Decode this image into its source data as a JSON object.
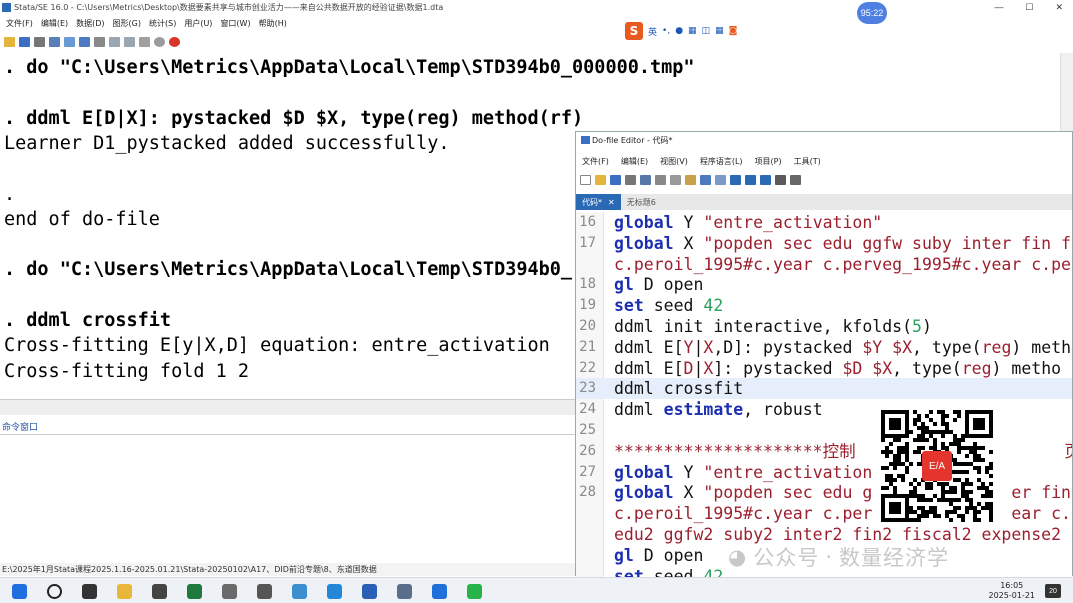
{
  "main_window": {
    "title": "Stata/SE 16.0 - C:\\Users\\Metrics\\Desktop\\数据要素共享与城市创业活力——来自公共数据开放的经验证据\\数据1.dta",
    "menu": [
      "文件(F)",
      "编辑(E)",
      "数据(D)",
      "图形(G)",
      "统计(S)",
      "用户(U)",
      "窗口(W)",
      "帮助(H)"
    ],
    "win_ctrls": [
      "—",
      "☐",
      "✕"
    ]
  },
  "ime": {
    "logo": "S",
    "label": "英"
  },
  "clock_badge": "95:22",
  "results": {
    "lines": [
      {
        "text": ". do \"C:\\Users\\Metrics\\AppData\\Local\\Temp\\STD394b0_000000.tmp\"",
        "cmd": true
      },
      {
        "text": "",
        "cmd": false
      },
      {
        "text": ". ddml E[D|X]: pystacked $D $X, type(reg) method(rf)",
        "cmd": true
      },
      {
        "text": "Learner D1_pystacked added successfully.",
        "cmd": false
      },
      {
        "text": "",
        "cmd": false
      },
      {
        "text": ".",
        "cmd": false
      },
      {
        "text": "end of do-file",
        "cmd": false
      },
      {
        "text": "",
        "cmd": false
      },
      {
        "text": ". do \"C:\\Users\\Metrics\\AppData\\Local\\Temp\\STD394b0_",
        "cmd": true
      },
      {
        "text": "",
        "cmd": false
      },
      {
        "text": ". ddml crossfit",
        "cmd": true
      },
      {
        "text": "Cross-fitting E[y|X,D] equation: entre_activation",
        "cmd": false
      },
      {
        "text": "Cross-fitting fold 1 2",
        "cmd": false
      }
    ]
  },
  "command_window_label": "命令窗口",
  "status_path": "E:\\2025年1月Stata课程2025.1.16-2025.01.21\\Stata-20250102\\A17、DID前沿专题\\8、东道国数据",
  "editor": {
    "title": "Do-file Editor - 代码*",
    "menu": [
      "文件(F)",
      "编辑(E)",
      "视图(V)",
      "程序语言(L)",
      "项目(P)",
      "工具(T)"
    ],
    "tabs": [
      {
        "label": "代码*",
        "close": "✕",
        "active": true
      },
      {
        "label": "无标题6",
        "close": "",
        "active": false
      }
    ],
    "lines": [
      {
        "no": "16",
        "tokens": [
          [
            "kw",
            "global"
          ],
          [
            "plain",
            " Y "
          ],
          [
            "str",
            "\"entre_activation\""
          ]
        ]
      },
      {
        "no": "17",
        "tokens": [
          [
            "kw",
            "global"
          ],
          [
            "plain",
            " X "
          ],
          [
            "str",
            "\"popden sec edu ggfw suby inter fin f"
          ]
        ]
      },
      {
        "no": "",
        "tokens": [
          [
            "str",
            "c.peroil_1995#c.year c.perveg_1995#c.year c.pe"
          ]
        ]
      },
      {
        "no": "18",
        "tokens": [
          [
            "kw",
            "gl"
          ],
          [
            "plain",
            " D open"
          ]
        ]
      },
      {
        "no": "19",
        "tokens": [
          [
            "kw",
            "set"
          ],
          [
            "plain",
            " seed "
          ],
          [
            "num",
            "42"
          ]
        ]
      },
      {
        "no": "20",
        "tokens": [
          [
            "plain",
            "ddml init interactive, kfolds("
          ],
          [
            "num",
            "5"
          ],
          [
            "plain",
            ")"
          ]
        ]
      },
      {
        "no": "21",
        "tokens": [
          [
            "plain",
            "ddml E["
          ],
          [
            "str",
            "Y"
          ],
          [
            "plain",
            "|"
          ],
          [
            "str",
            "X"
          ],
          [
            "plain",
            ",D]: pystacked "
          ],
          [
            "str",
            "$Y $X"
          ],
          [
            "plain",
            ", type("
          ],
          [
            "str",
            "reg"
          ],
          [
            "plain",
            ") meth"
          ]
        ]
      },
      {
        "no": "22",
        "tokens": [
          [
            "plain",
            "ddml E["
          ],
          [
            "str",
            "D"
          ],
          [
            "plain",
            "|"
          ],
          [
            "str",
            "X"
          ],
          [
            "plain",
            "]: pystacked "
          ],
          [
            "str",
            "$D $X"
          ],
          [
            "plain",
            ", type("
          ],
          [
            "str",
            "reg"
          ],
          [
            "plain",
            ") metho"
          ]
        ]
      },
      {
        "no": "23",
        "tokens": [
          [
            "plain",
            "ddml crossfit"
          ]
        ],
        "hl": true
      },
      {
        "no": "24",
        "tokens": [
          [
            "plain",
            "ddml "
          ],
          [
            "kw",
            "estimate"
          ],
          [
            "plain",
            ", robust"
          ]
        ]
      },
      {
        "no": "25",
        "tokens": []
      },
      {
        "no": "26",
        "tokens": [
          [
            "str",
            "*********************控制"
          ],
          [
            "plain",
            "                     "
          ],
          [
            "str",
            "页******"
          ]
        ]
      },
      {
        "no": "27",
        "tokens": [
          [
            "kw",
            "global"
          ],
          [
            "plain",
            " Y "
          ],
          [
            "str",
            "\"entre_activation"
          ]
        ]
      },
      {
        "no": "28",
        "tokens": [
          [
            "kw",
            "global"
          ],
          [
            "plain",
            " X "
          ],
          [
            "str",
            "\"popden sec edu g"
          ],
          [
            "plain",
            "              "
          ],
          [
            "str",
            "er fin f"
          ]
        ]
      },
      {
        "no": "",
        "tokens": [
          [
            "str",
            "c.peroil_1995#c.year c.per"
          ],
          [
            "plain",
            "              "
          ],
          [
            "str",
            "ear c.pe"
          ]
        ]
      },
      {
        "no": "",
        "tokens": [
          [
            "str",
            "edu2 ggfw2 suby2 inter2 fin2 fiscal2 expense2"
          ]
        ]
      },
      {
        "no": "",
        "tokens": [
          [
            "kw",
            "gl"
          ],
          [
            "plain",
            " D open"
          ]
        ]
      },
      {
        "no": "",
        "tokens": [
          [
            "kw",
            "set"
          ],
          [
            "plain",
            " seed "
          ],
          [
            "num",
            "42"
          ]
        ]
      }
    ]
  },
  "qr_center_text": "E/A",
  "watermark": {
    "left": "公众号",
    "dot": "·",
    "right": "数量经济学"
  },
  "taskbar": {
    "time": "16:05",
    "date": "2025-01-21",
    "notif": "20",
    "icons": [
      "windows-start",
      "search",
      "task-view",
      "explorer",
      "panda",
      "excel",
      "taskmgr",
      "typora",
      "edge-old",
      "edge",
      "word",
      "shield",
      "browser",
      "wechat"
    ],
    "icon_colors": [
      "#1f6fe0",
      "#222222",
      "#333333",
      "#e8b73a",
      "#444444",
      "#1e7a3c",
      "#6a6a6a",
      "#555555",
      "#3b8fd1",
      "#2387d8",
      "#2b5fb5",
      "#5a6d8a",
      "#1e6fd8",
      "#28b34a"
    ]
  }
}
